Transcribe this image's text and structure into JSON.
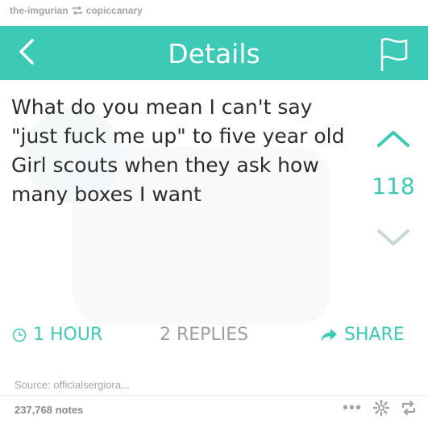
{
  "attribution": {
    "from_blog": "the-imgurian",
    "to_blog": "copiccanary"
  },
  "header": {
    "title": "Details"
  },
  "post": {
    "lines": [
      "What do you mean I can't say",
      "\"just fuck me up\" to five year old",
      "Girl scouts when they ask how",
      "many boxes I want"
    ],
    "vote_count": "118"
  },
  "footer": {
    "time": "1 HOUR",
    "replies": "2 REPLIES",
    "share": "SHARE"
  },
  "source": "Source: officialsergiora...",
  "notes": "237,768 notes",
  "colors": {
    "accent": "#3cc9b6",
    "text": "#2c2c2c",
    "muted": "#9aa0a4"
  }
}
